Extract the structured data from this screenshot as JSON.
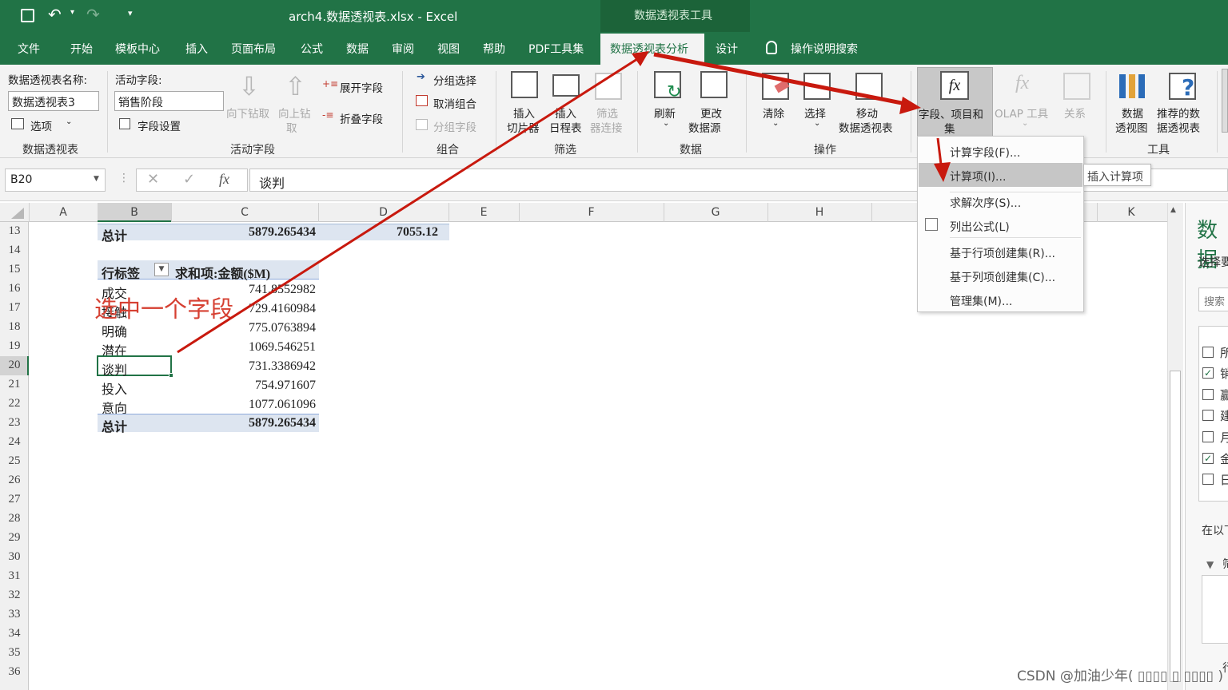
{
  "window": {
    "file_title": "arch4.数据透视表.xlsx  -  Excel",
    "context_tab_group": "数据透视表工具"
  },
  "tabs": [
    "文件",
    "开始",
    "模板中心",
    "插入",
    "页面布局",
    "公式",
    "数据",
    "审阅",
    "视图",
    "帮助",
    "PDF工具集",
    "数据透视表分析",
    "设计"
  ],
  "tell_me": "操作说明搜索",
  "ribbon": {
    "pivot_name_label": "数据透视表名称:",
    "pivot_name_value": "数据透视表3",
    "options_label": "选项",
    "group_pivot": "数据透视表",
    "active_field_label": "活动字段:",
    "active_field_value": "销售阶段",
    "field_settings": "字段设置",
    "drill_down": [
      "向下钻取"
    ],
    "drill_up": [
      "向上钻",
      "取"
    ],
    "expand_field": "展开字段",
    "collapse_field": "折叠字段",
    "group_active": "活动字段",
    "group_selection": "分组选择",
    "ungroup": "取消组合",
    "group_field": "分组字段",
    "group_group": "组合",
    "insert_slicer": [
      "插入",
      "切片器"
    ],
    "insert_timeline": [
      "插入",
      "日程表"
    ],
    "filter_connections": [
      "筛选",
      "器连接"
    ],
    "group_filter": "筛选",
    "refresh": "刷新",
    "change_source": [
      "更改",
      "数据源"
    ],
    "group_data": "数据",
    "clear": "清除",
    "select": "选择",
    "move_pivot": [
      "移动",
      "数据透视表"
    ],
    "group_actions": "操作",
    "fields_items": [
      "字段、项目和",
      "集"
    ],
    "olap": "OLAP 工具",
    "relationships": "关系",
    "pivot_chart": [
      "数据",
      "透视图"
    ],
    "recommended": [
      "推荐的数",
      "据透视表"
    ],
    "group_tools": "工具"
  },
  "formula_bar": {
    "name_box": "B20",
    "value": "谈判"
  },
  "columns": [
    "A",
    "B",
    "C",
    "D",
    "E",
    "F",
    "G",
    "H",
    "K"
  ],
  "rows": [
    "13",
    "14",
    "15",
    "16",
    "17",
    "18",
    "19",
    "20",
    "21",
    "22",
    "23",
    "24",
    "25",
    "26",
    "27",
    "28",
    "29",
    "30",
    "31",
    "32",
    "33",
    "34",
    "35",
    "36"
  ],
  "sheet": {
    "row13": {
      "label": "总计",
      "c": "5879.265434",
      "d": "7055.12"
    },
    "header": {
      "label": "行标签",
      "value": "求和项:金额($M)"
    },
    "items": [
      {
        "label": "成交",
        "value": "741.8552982"
      },
      {
        "label": "接触",
        "value": "729.4160984"
      },
      {
        "label": "明确",
        "value": "775.0763894"
      },
      {
        "label": "潜在",
        "value": "1069.546251"
      },
      {
        "label": "谈判",
        "value": "731.3386942"
      },
      {
        "label": "投入",
        "value": "754.971607"
      },
      {
        "label": "意向",
        "value": "1077.061096"
      }
    ],
    "total": {
      "label": "总计",
      "value": "5879.265434"
    }
  },
  "annotation": "选中一个字段",
  "dropdown": [
    "计算字段(F)...",
    "计算项(I)...",
    "求解次序(S)...",
    "列出公式(L)",
    "基于行项创建集(R)...",
    "基于列项创建集(C)...",
    "管理集(M)..."
  ],
  "tooltip": "插入计算项",
  "field_pane": {
    "title": "数据",
    "choose_label": "选择要",
    "search": "搜索",
    "fields": [
      "所",
      "销",
      "赢",
      "建",
      "月",
      "金",
      "日"
    ],
    "area_label": "在以下",
    "filter_label": "筛",
    "rows_label": "行"
  },
  "watermark": "CSDN @加油少年( ▯▯▯▯ ▯ ▯▯▯▯ )",
  "colors": {
    "excel_green": "#217346",
    "arrow_red": "#c8190e",
    "selected_tab": "#f3f3f3"
  }
}
